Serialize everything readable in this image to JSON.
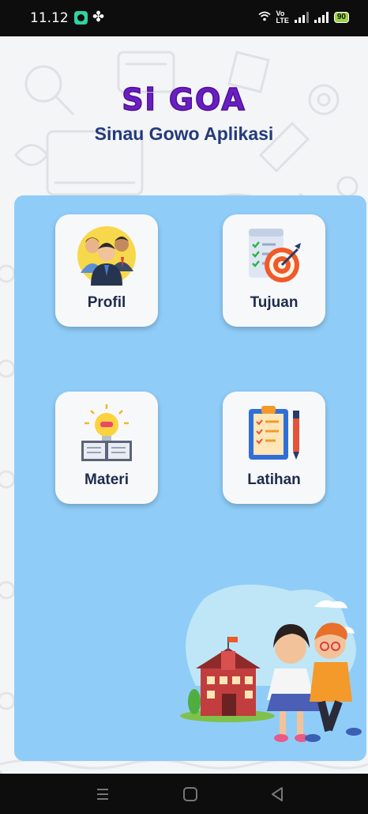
{
  "status_bar": {
    "time": "11.12",
    "network_type": "LTE",
    "volte": "Vo",
    "battery": "90"
  },
  "header": {
    "title": "Si GOA",
    "subtitle": "Sinau Gowo Aplikasi"
  },
  "menu": {
    "items": [
      {
        "label": "Profil",
        "icon": "people-icon"
      },
      {
        "label": "Tujuan",
        "icon": "target-checklist-icon"
      },
      {
        "label": "Materi",
        "icon": "lightbulb-book-icon"
      },
      {
        "label": "Latihan",
        "icon": "clipboard-pencil-icon"
      }
    ]
  },
  "colors": {
    "title": "#6a1fc1",
    "subtitle": "#243a7a",
    "panel": "#8fcdf8",
    "card": "#f7f8fa"
  }
}
